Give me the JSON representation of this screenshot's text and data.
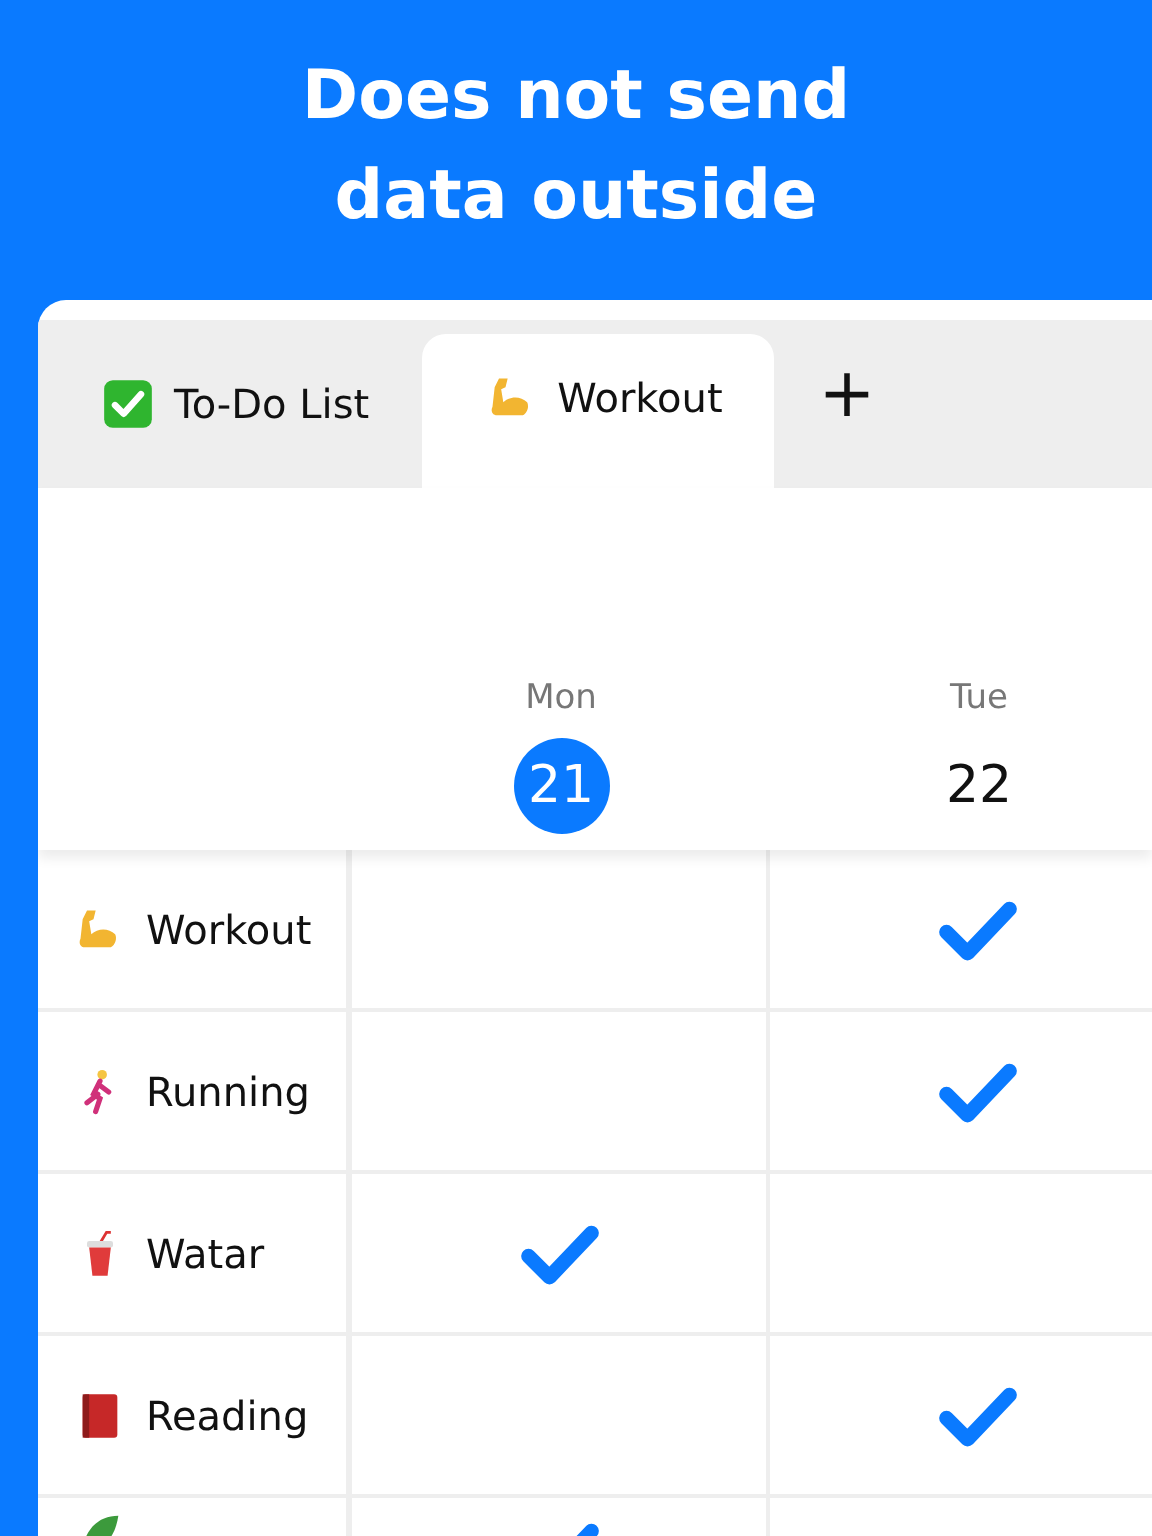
{
  "headline": [
    "Does not send",
    "data outside"
  ],
  "tabs": [
    {
      "label": "To-Do List",
      "selected": false
    },
    {
      "label": "Workout",
      "selected": true
    }
  ],
  "add_tab": "+",
  "days": [
    {
      "name": "Mon",
      "date": "21",
      "selected": true
    },
    {
      "name": "Tue",
      "date": "22",
      "selected": false
    }
  ],
  "habits": [
    {
      "label": "Workout",
      "checks": [
        false,
        true
      ]
    },
    {
      "label": "Running",
      "checks": [
        false,
        true
      ]
    },
    {
      "label": "Watar",
      "checks": [
        true,
        false
      ]
    },
    {
      "label": "Reading",
      "checks": [
        false,
        true
      ]
    },
    {
      "checks": [
        true,
        false
      ]
    }
  ]
}
